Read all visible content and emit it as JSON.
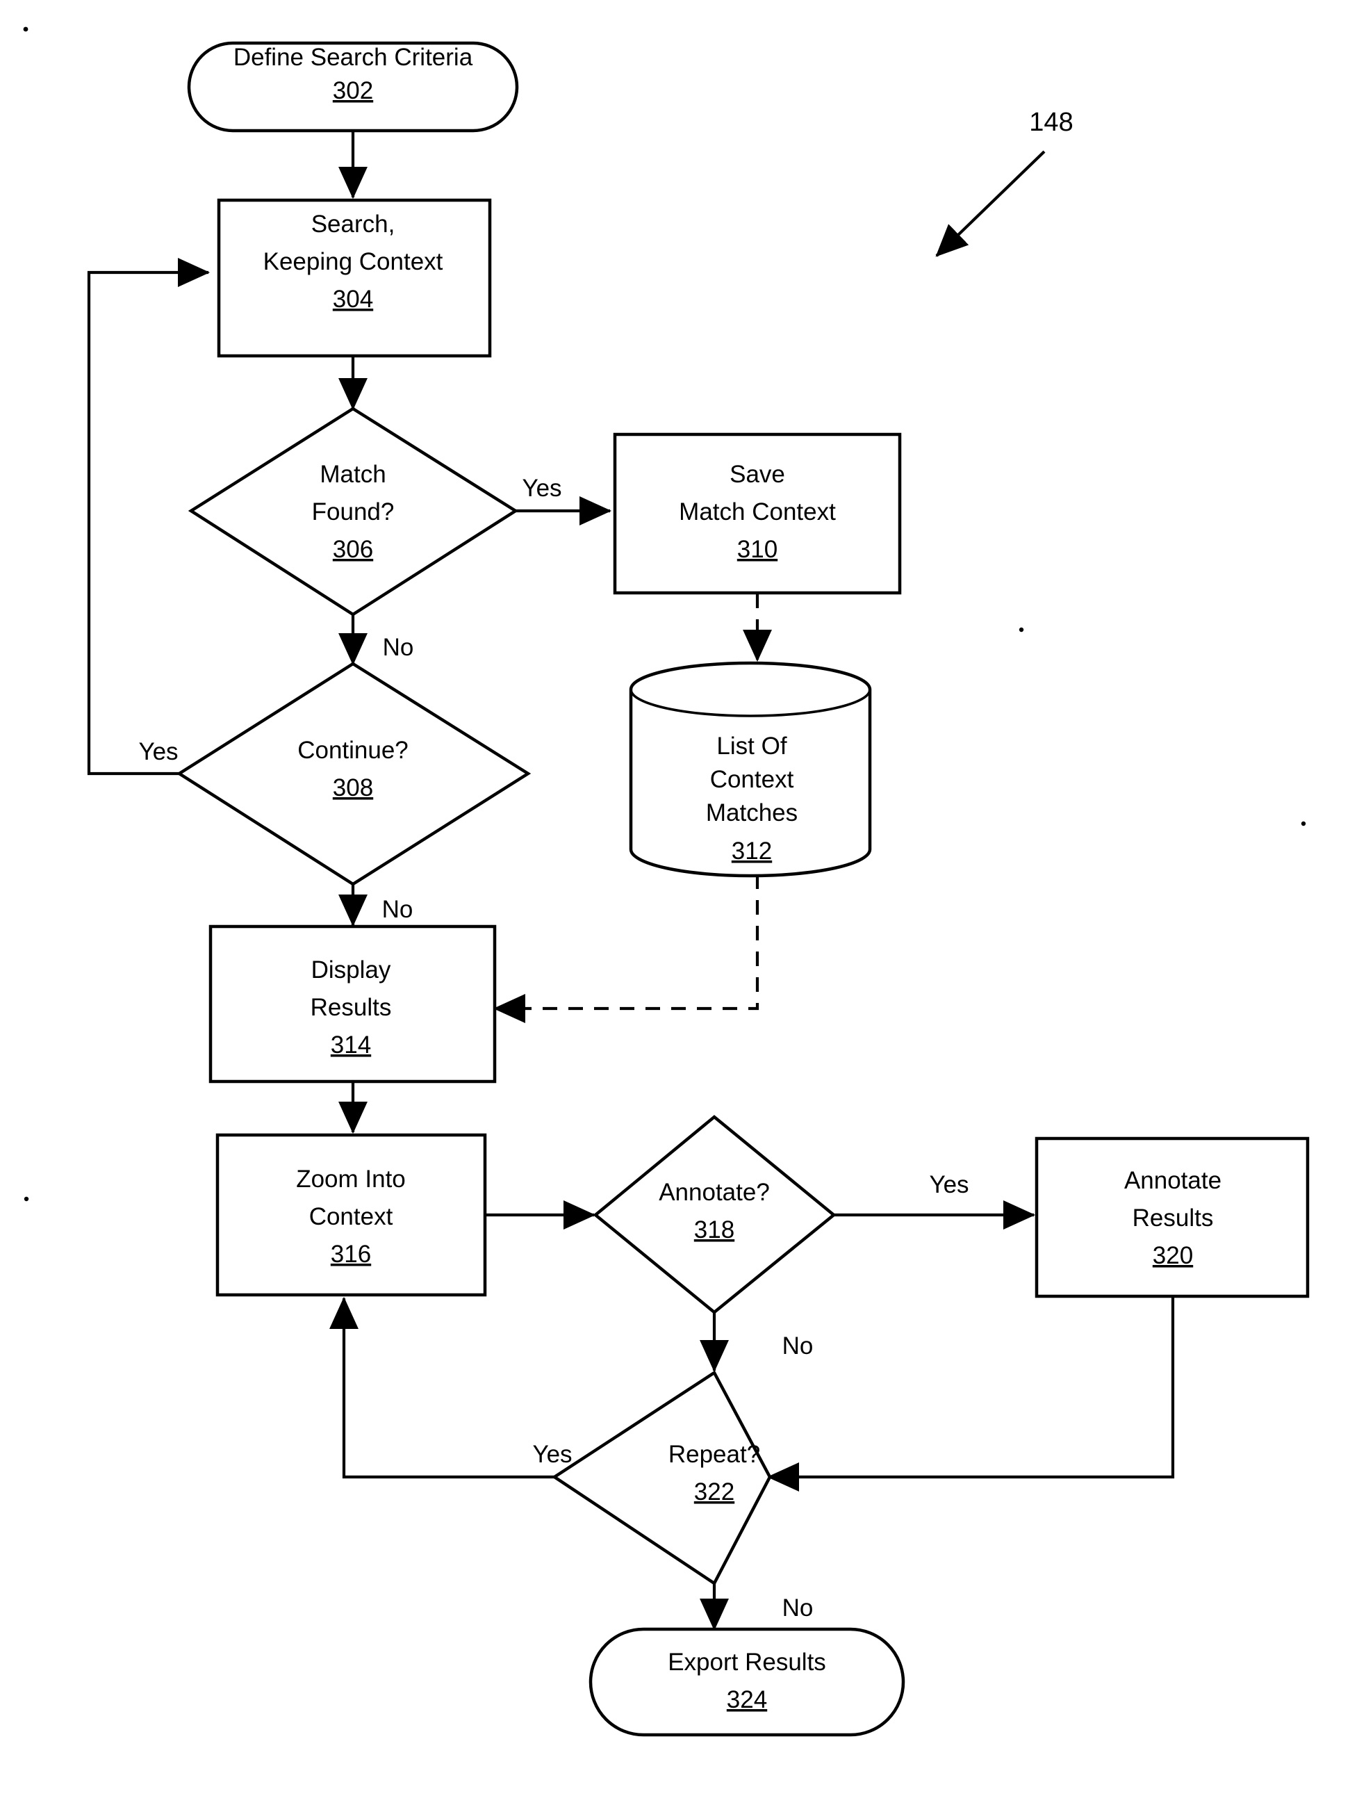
{
  "figure": {
    "reference_label": "148",
    "type": "flowchart"
  },
  "nodes": {
    "define_search": {
      "label_line1": "Define Search Criteria",
      "ref": "302",
      "shape": "stadium"
    },
    "search_keeping": {
      "label_line1": "Search,",
      "label_line2": "Keeping Context",
      "ref": "304",
      "shape": "rect"
    },
    "match_found": {
      "label_line1": "Match",
      "label_line2": "Found?",
      "ref": "306",
      "shape": "diamond"
    },
    "save_match": {
      "label_line1": "Save",
      "label_line2": "Match Context",
      "ref": "310",
      "shape": "rect"
    },
    "continue": {
      "label_line1": "Continue?",
      "ref": "308",
      "shape": "diamond"
    },
    "list_context": {
      "label_line1": "List Of",
      "label_line2": "Context",
      "label_line3": "Matches",
      "ref": "312",
      "shape": "cylinder"
    },
    "display_results": {
      "label_line1": "Display",
      "label_line2": "Results",
      "ref": "314",
      "shape": "rect"
    },
    "zoom_into": {
      "label_line1": "Zoom Into",
      "label_line2": "Context",
      "ref": "316",
      "shape": "rect"
    },
    "annotate_q": {
      "label_line1": "Annotate?",
      "ref": "318",
      "shape": "diamond"
    },
    "annotate_results": {
      "label_line1": "Annotate",
      "label_line2": "Results",
      "ref": "320",
      "shape": "rect"
    },
    "repeat_q": {
      "label_line1": "Repeat?",
      "ref": "322",
      "shape": "diamond"
    },
    "export_results": {
      "label_line1": "Export Results",
      "ref": "324",
      "shape": "stadium"
    }
  },
  "edge_labels": {
    "match_yes": "Yes",
    "match_no": "No",
    "continue_yes": "Yes",
    "continue_no": "No",
    "annotate_yes": "Yes",
    "annotate_no": "No",
    "repeat_yes": "Yes",
    "repeat_no": "No"
  },
  "colors": {
    "stroke": "#000000",
    "fill": "#ffffff",
    "background": "#ffffff"
  }
}
